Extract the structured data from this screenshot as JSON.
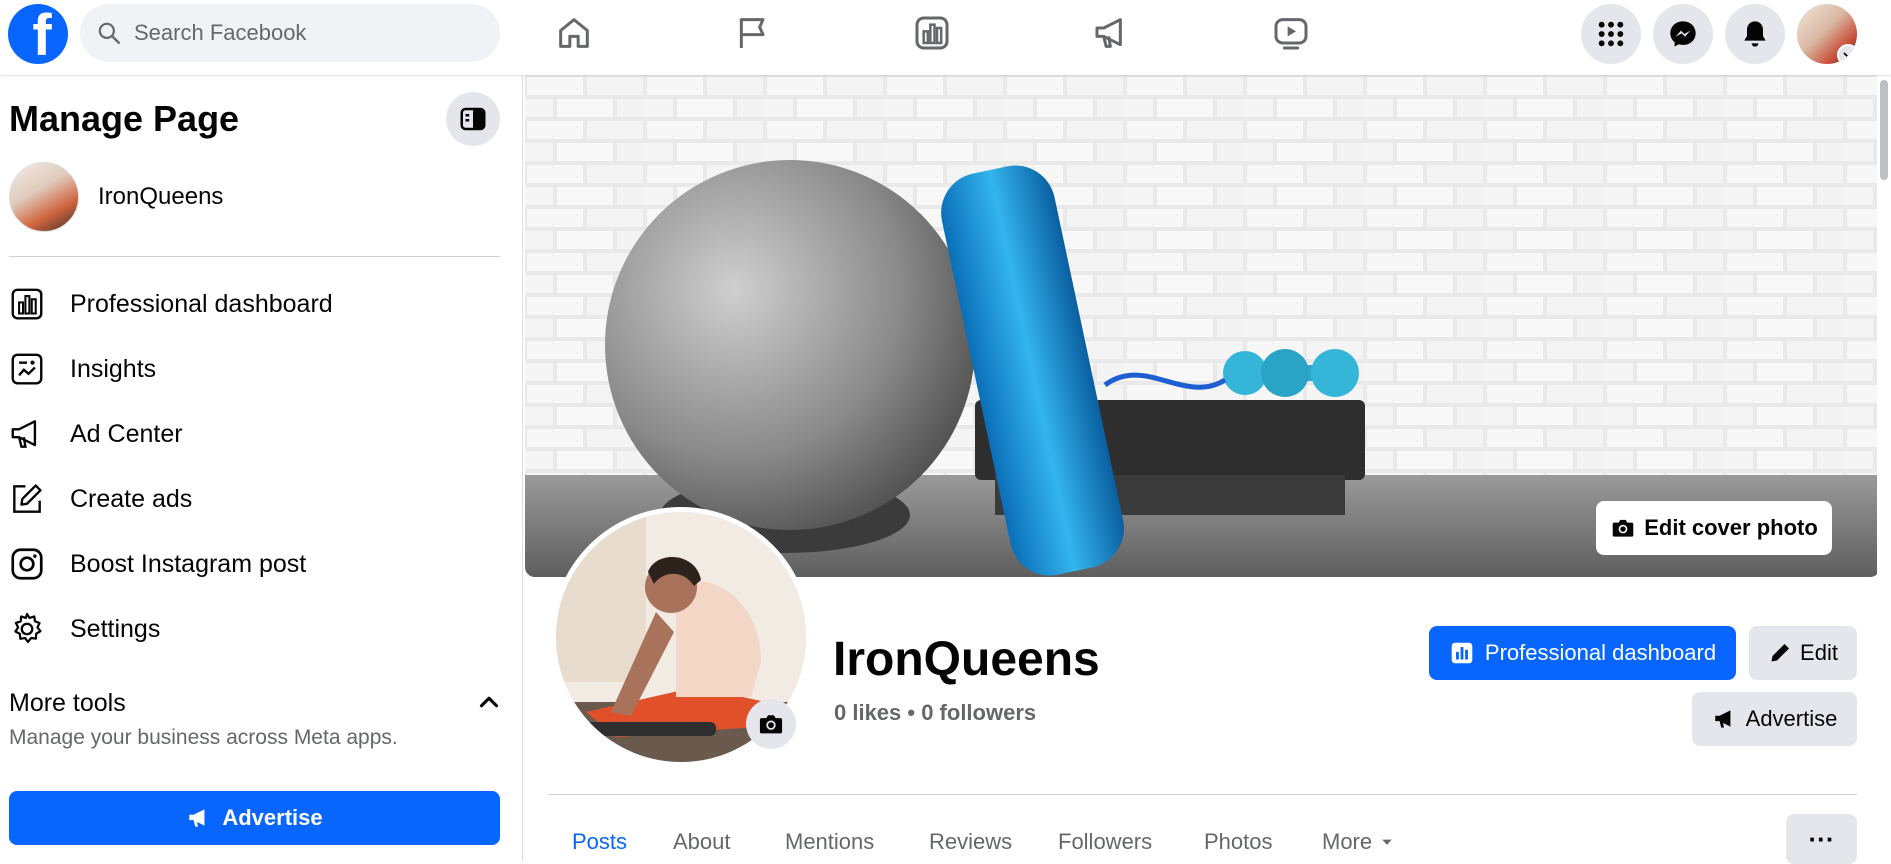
{
  "topbar": {
    "logo_letter": "f",
    "search_placeholder": "Search Facebook"
  },
  "sidebar": {
    "title": "Manage Page",
    "page_name": "IronQueens",
    "items": [
      {
        "label": "Professional dashboard",
        "icon": "dashboard-icon"
      },
      {
        "label": "Insights",
        "icon": "insights-icon"
      },
      {
        "label": "Ad Center",
        "icon": "megaphone-icon"
      },
      {
        "label": "Create ads",
        "icon": "pencil-square-icon"
      },
      {
        "label": "Boost Instagram post",
        "icon": "instagram-icon"
      },
      {
        "label": "Settings",
        "icon": "gear-icon"
      }
    ],
    "more_tools_label": "More tools",
    "more_tools_sub": "Manage your business across Meta apps.",
    "advertise_label": "Advertise"
  },
  "main": {
    "edit_cover_label": "Edit cover photo",
    "page_name": "IronQueens",
    "stats": "0 likes • 0 followers",
    "professional_dashboard_label": "Professional dashboard",
    "edit_label": "Edit",
    "advertise_label": "Advertise",
    "tabs": [
      "Posts",
      "About",
      "Mentions",
      "Reviews",
      "Followers",
      "Photos",
      "More"
    ],
    "more_dots": "···"
  },
  "colors": {
    "brand": "#0866ff",
    "button_gray": "#e4e6eb",
    "secondary_text": "#65676b"
  }
}
